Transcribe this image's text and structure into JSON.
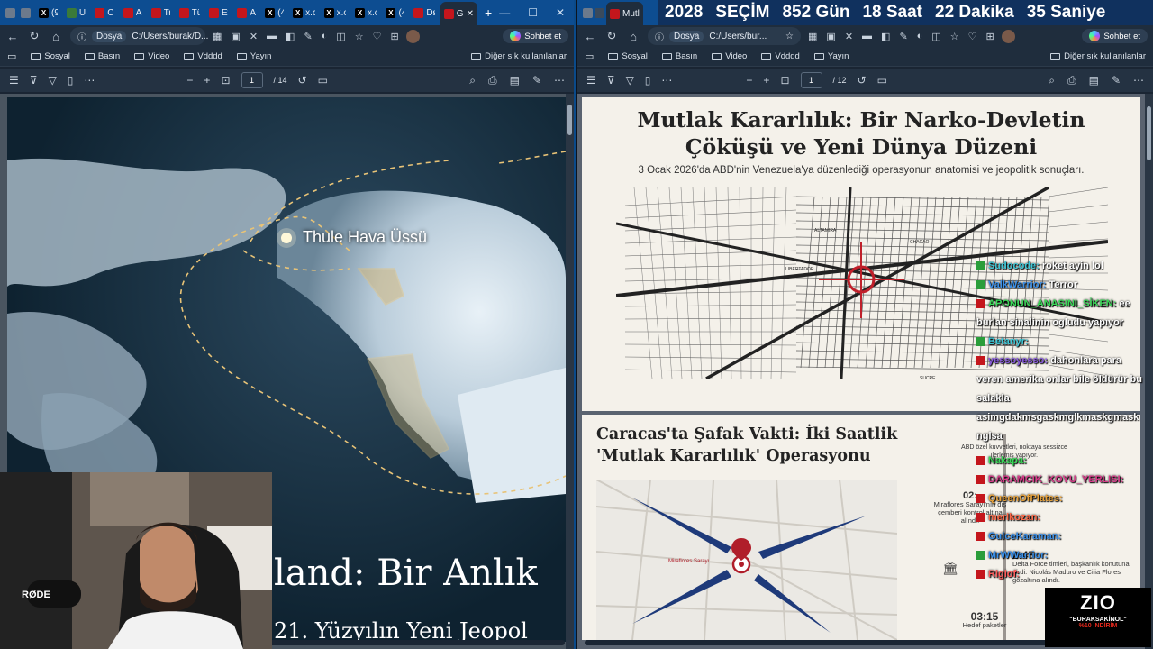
{
  "left_window": {
    "tabs": [
      {
        "label": "",
        "icon": "w"
      },
      {
        "label": "(9",
        "icon": "x"
      },
      {
        "label": "Ul",
        "icon": "g"
      },
      {
        "label": "Cl",
        "icon": "r"
      },
      {
        "label": "Al",
        "icon": "r"
      },
      {
        "label": "Tr",
        "icon": "r"
      },
      {
        "label": "Tü",
        "icon": "r"
      },
      {
        "label": "Et",
        "icon": "r"
      },
      {
        "label": "Al",
        "icon": "r"
      },
      {
        "label": "(4",
        "icon": "x"
      },
      {
        "label": "x.c",
        "icon": "x"
      },
      {
        "label": "x.c",
        "icon": "x"
      },
      {
        "label": "x.c",
        "icon": "x"
      },
      {
        "label": "(4",
        "icon": "x"
      },
      {
        "label": "Dε",
        "icon": "r"
      },
      {
        "label": "Gr",
        "icon": "r",
        "active": true
      }
    ],
    "address_label": "Dosya",
    "address_url": "C:/Users/burak/D...",
    "copilot_label": "Sohbet et",
    "bookmarks": [
      "Sosyal",
      "Basın",
      "Video",
      "Vdddd",
      "Yayın"
    ],
    "bookmarks_other": "Diğer sık kullanılanlar",
    "page_current": "1",
    "page_total": "/ 14",
    "map_label": "Thule Hava Üssü",
    "slide_title_partial": "land: Bir Anlık",
    "slide_subtitle_partial": "21. Yüzyılın Yeni Jeopol"
  },
  "right_window": {
    "active_tab_label": "Mutl",
    "address_label": "Dosya",
    "address_url": "C:/Users/bur...",
    "copilot_label": "Sohbet et",
    "bookmarks": [
      "Sosyal",
      "Basın",
      "Video",
      "Vdddd",
      "Yayın"
    ],
    "bookmarks_other": "Diğer sık kullanılanlar",
    "page_current": "1",
    "page_total": "/ 12",
    "slide1": {
      "title_line1": "Mutlak Kararlılık: Bir Narko-Devletin",
      "title_line2": "Çöküşü ve Yeni Dünya Düzeni",
      "subtitle": "3 Ocak 2026'da ABD'nin Venezuela'ya düzenlediği operasyonun anatomisi ve jeopolitik sonuçları.",
      "map_labels": [
        "ALTAMIRA",
        "CHACAO",
        "LIBERTADOR",
        "SUCRE"
      ]
    },
    "slide2": {
      "title_line1": "Caracas'ta Şafak Vakti: İki Saatlik",
      "title_line2": "'Mutlak Kararlılık' Operasyonu",
      "map_label": "Miraflores Sarayı",
      "timeline": [
        {
          "time": "",
          "text": "ABD özel kuvvetleri, noktaya sessizce ilerlemiş yapıyor."
        },
        {
          "time": "02:",
          "text": "Miraflores Sarayı'nın dış çemberi kontrol altına alındı."
        },
        {
          "time": "2:45",
          "text": "Delta Force timleri, başkanlık konutuna girdi. Nicolás Maduro ve Cilia Flores gözaltına alındı."
        },
        {
          "time": "03:15",
          "text": "Hedef paketler"
        }
      ]
    }
  },
  "overlay": {
    "countdown": [
      "2028",
      "SEÇİM",
      "852 Gün",
      "18 Saat",
      "22 Dakika",
      "35 Saniye"
    ],
    "chat": [
      {
        "user": "Sudocode",
        "msg": "roket ayin lol",
        "color": "#3ec8d8",
        "badge": "#2a9d3a"
      },
      {
        "user": "ValkWarrior",
        "msg": "Terror",
        "color": "#3a8fe8",
        "badge": "#2a9d3a"
      },
      {
        "user": "APONUN_ANASINI_SİKEN",
        "msg": "ee burlan sinalinin ogludu yapıyor",
        "color": "#3ad858",
        "badge": "#c4161c"
      },
      {
        "user": "Betanyr",
        "msg": "",
        "color": "#3ec8d8",
        "badge": "#2a9d3a"
      },
      {
        "user": "yessoyesso",
        "msg": "dahonlara para veren amerika onlar bile öldürür bu salakla",
        "color": "#8a5adf",
        "badge": "#c4161c"
      },
      {
        "user": "",
        "msg": "asimgdakmsgaskmglkmaskgmask nglsa",
        "color": "#ffffff",
        "badge": ""
      },
      {
        "user": "Nakapa",
        "msg": "",
        "color": "#3ad858",
        "badge": "#c4161c"
      },
      {
        "user": "DARAMCIK_KOYU_YERLISI",
        "msg": "",
        "color": "#d83a8a",
        "badge": "#c4161c"
      },
      {
        "user": "QueenOfPlates",
        "msg": "",
        "color": "#e8a23a",
        "badge": "#c4161c"
      },
      {
        "user": "merlkozan",
        "msg": "",
        "color": "#ff6a4a",
        "badge": "#c4161c"
      },
      {
        "user": "GulceKaraman",
        "msg": "",
        "color": "#3a8fe8",
        "badge": "#c4161c"
      },
      {
        "user": "MrWWarrior",
        "msg": "",
        "color": "#3a8fe8",
        "badge": "#2a9d3a"
      },
      {
        "user": "Rigiof",
        "msg": "",
        "color": "#ff5a5a",
        "badge": "#c4161c"
      }
    ],
    "brand_logo": "ZIO",
    "brand_line1": "\"BURAKSAKİNOL\"",
    "brand_line2": "%10 İNDİRİM",
    "mic_brand": "RØDE"
  },
  "icons": [
    "back-icon",
    "refresh-icon",
    "home-icon",
    "info-icon",
    "star-icon",
    "menu-icon",
    "filter-icon",
    "split-icon",
    "more-icon",
    "zoom-out-icon",
    "zoom-in-icon",
    "fit-icon",
    "rotate-icon",
    "sidebar-icon",
    "search-icon",
    "print-icon",
    "save-icon",
    "draw-icon"
  ]
}
